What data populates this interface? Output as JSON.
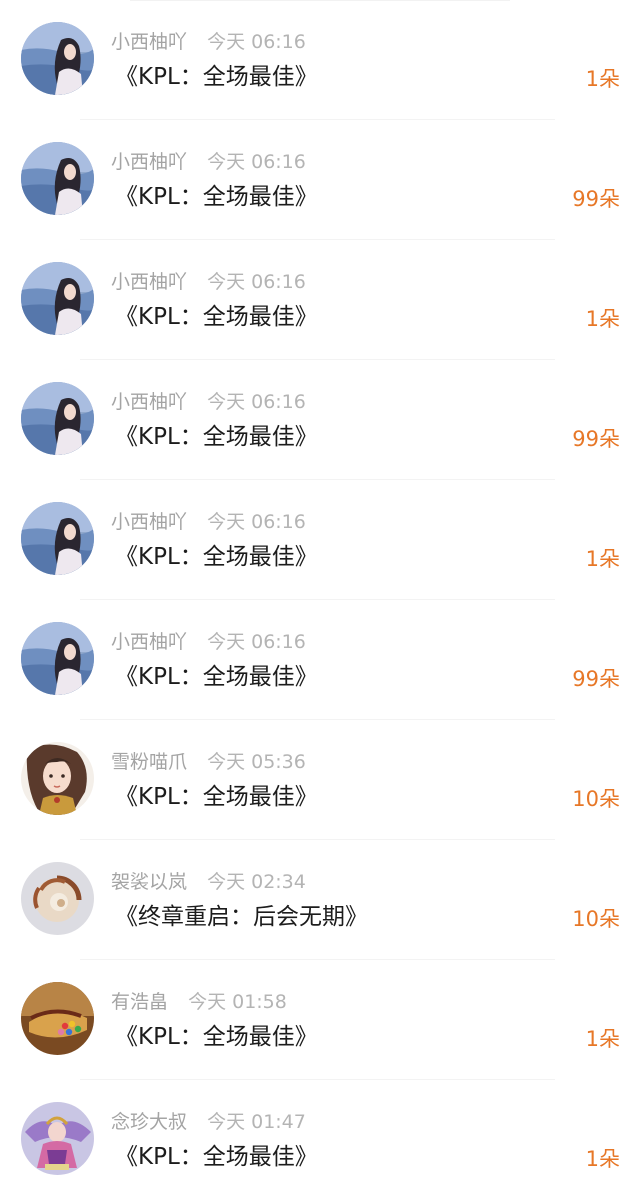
{
  "colors": {
    "count_accent": "#e77727",
    "meta_text": "#a4a4a4",
    "title_text": "#1c1c1c"
  },
  "items": [
    {
      "name": "小西柚吖",
      "time": "今天 06:16",
      "title": "《KPL：全场最佳》",
      "count": "1朵",
      "avatar": "girl-sea-avatar"
    },
    {
      "name": "小西柚吖",
      "time": "今天 06:16",
      "title": "《KPL：全场最佳》",
      "count": "99朵",
      "avatar": "girl-sea-avatar"
    },
    {
      "name": "小西柚吖",
      "time": "今天 06:16",
      "title": "《KPL：全场最佳》",
      "count": "1朵",
      "avatar": "girl-sea-avatar"
    },
    {
      "name": "小西柚吖",
      "time": "今天 06:16",
      "title": "《KPL：全场最佳》",
      "count": "99朵",
      "avatar": "girl-sea-avatar"
    },
    {
      "name": "小西柚吖",
      "time": "今天 06:16",
      "title": "《KPL：全场最佳》",
      "count": "1朵",
      "avatar": "girl-sea-avatar"
    },
    {
      "name": "小西柚吖",
      "time": "今天 06:16",
      "title": "《KPL：全场最佳》",
      "count": "99朵",
      "avatar": "girl-sea-avatar"
    },
    {
      "name": "雪粉喵爪",
      "time": "今天 05:36",
      "title": "《KPL：全场最佳》",
      "count": "10朵",
      "avatar": "anime-girl-avatar"
    },
    {
      "name": "袈裟以岚",
      "time": "今天 02:34",
      "title": "《终章重启：后会无期》",
      "count": "10朵",
      "avatar": "nautilus-shell-avatar"
    },
    {
      "name": "有浩畠",
      "time": "今天 01:58",
      "title": "《KPL：全场最佳》",
      "count": "1朵",
      "avatar": "candy-jar-avatar"
    },
    {
      "name": "念珍大叔",
      "time": "今天 01:47",
      "title": "《KPL：全场最佳》",
      "count": "1朵",
      "avatar": "game-character-avatar"
    }
  ]
}
